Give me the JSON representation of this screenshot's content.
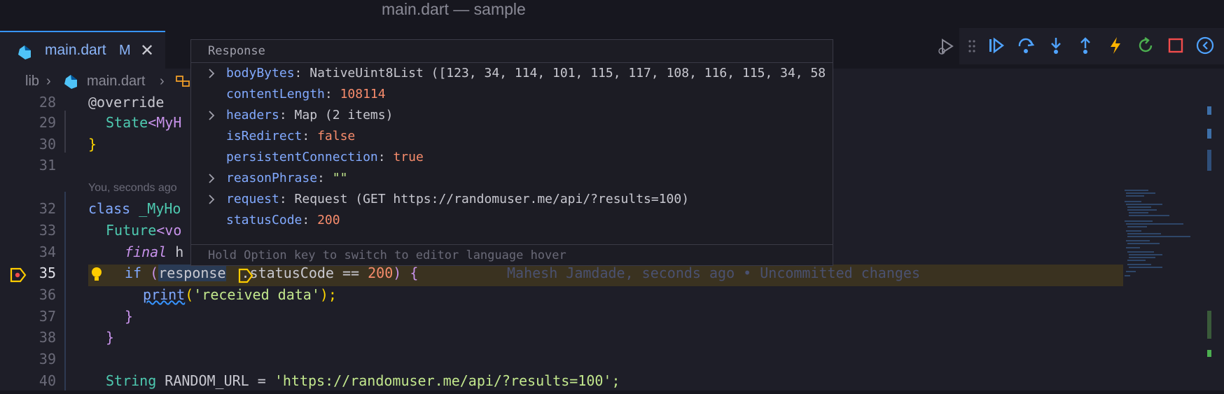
{
  "window": {
    "title": "main.dart — sample"
  },
  "tab": {
    "name": "main.dart",
    "modified": "M"
  },
  "breadcrumb": {
    "folder": "lib",
    "file": "main.dart"
  },
  "codelens_top": "You, seconds ago",
  "lines": [
    {
      "n": "28"
    },
    {
      "n": "29"
    },
    {
      "n": "30"
    },
    {
      "n": "31"
    },
    {
      "n": "32"
    },
    {
      "n": "33"
    },
    {
      "n": "34"
    },
    {
      "n": "35"
    },
    {
      "n": "36"
    },
    {
      "n": "37"
    },
    {
      "n": "38"
    },
    {
      "n": "39"
    },
    {
      "n": "40"
    }
  ],
  "code": {
    "l28": "@override",
    "l29_type": "State",
    "l29_rest": "<MyH",
    "l30": "}",
    "l32_kw": "class",
    "l32_name": " _MyHo",
    "l33_type": "Future",
    "l33_rest": "<vo",
    "l34_kw": "final",
    "l34_rest": " h",
    "l35_if": "if",
    "l35_open": " (",
    "l35_var": "response",
    "l35_rest": ".statusCode == ",
    "l35_num": "200",
    "l35_close": ") {",
    "l35_blame": "Mahesh Jamdade, seconds ago • Uncommitted changes",
    "l36_fn": "print",
    "l36_str": "'received data'",
    "l36_end": ");",
    "l37": "}",
    "l38": "}",
    "l40_type": "String",
    "l40_name": " RANDOM_URL = ",
    "l40_str": "'https://randomuser.me/api/?results=100';"
  },
  "hover": {
    "header": "Response",
    "rows": [
      {
        "key": "bodyBytes",
        "value": "NativeUint8List ([123, 34, 114, 101, 115, 117, 108, 116, 115, 34, 58",
        "expandable": true
      },
      {
        "key": "contentLength",
        "value": "108114",
        "expandable": false
      },
      {
        "key": "headers",
        "value": "Map (2 items)",
        "expandable": true
      },
      {
        "key": "isRedirect",
        "value": "false",
        "expandable": false
      },
      {
        "key": "persistentConnection",
        "value": "true",
        "expandable": false
      },
      {
        "key": "reasonPhrase",
        "value": "\"\"",
        "expandable": true
      },
      {
        "key": "request",
        "value": "Request (GET https://randomuser.me/api/?results=100)",
        "expandable": true
      },
      {
        "key": "statusCode",
        "value": "200",
        "expandable": false
      }
    ],
    "footer": "Hold Option key to switch to editor language hover"
  },
  "toolbar_icons": [
    "grip-icon",
    "continue-icon",
    "step-over-icon",
    "step-into-icon",
    "step-out-icon",
    "hot-reload-icon",
    "restart-icon",
    "stop-icon",
    "devtools-icon"
  ],
  "colors": {
    "accent": "#3794ff",
    "keyword": "#82aaff",
    "number": "#f78c6c",
    "string": "#c3e88d",
    "breakpoint": "#ffcc00"
  }
}
